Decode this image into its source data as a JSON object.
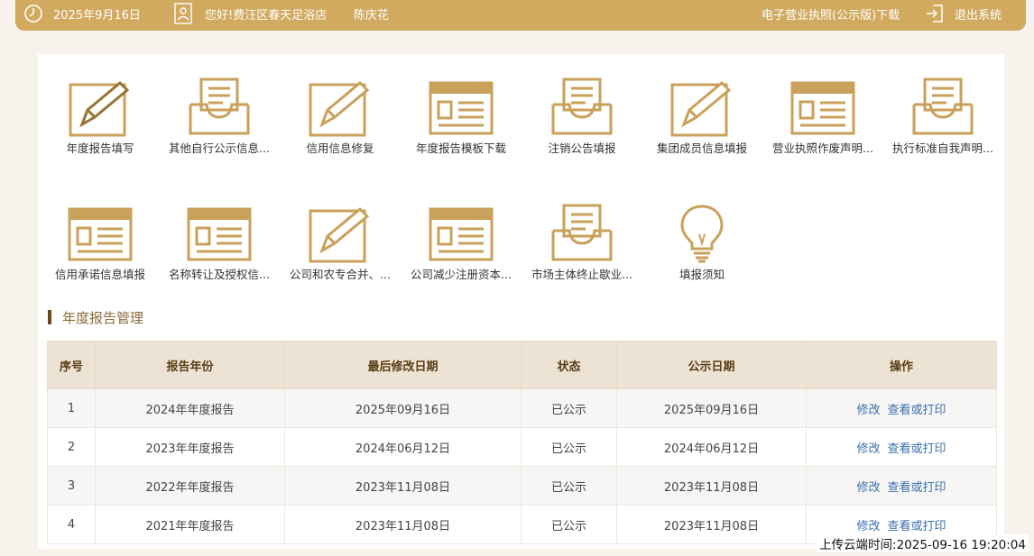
{
  "header": {
    "date": "2025年9月16日",
    "greeting": "您好!费汪区春天足浴店",
    "user_name": "陈庆花",
    "license_download": "电子营业执照(公示版)下载",
    "logout": "退出系统"
  },
  "tiles": [
    {
      "label": "年度报告填写",
      "icon": "pencil-form-icon"
    },
    {
      "label": "其他自行公示信息...",
      "icon": "inbox-tray-icon"
    },
    {
      "label": "信用信息修复",
      "icon": "pencil-form-icon"
    },
    {
      "label": "年度报告模板下载",
      "icon": "window-form-icon"
    },
    {
      "label": "注销公告填报",
      "icon": "inbox-tray-icon"
    },
    {
      "label": "集团成员信息填报",
      "icon": "pencil-form-icon"
    },
    {
      "label": "营业执照作废声明...",
      "icon": "window-form-icon"
    },
    {
      "label": "执行标准自我声明...",
      "icon": "inbox-tray-icon"
    },
    {
      "label": "信用承诺信息填报",
      "icon": "window-form-icon"
    },
    {
      "label": "名称转让及授权信...",
      "icon": "window-form-icon"
    },
    {
      "label": "公司和农专合并、...",
      "icon": "pencil-form-icon"
    },
    {
      "label": "公司减少注册资本...",
      "icon": "window-form-icon"
    },
    {
      "label": "市场主体终止歇业...",
      "icon": "inbox-tray-icon"
    },
    {
      "label": "填报须知",
      "icon": "lightbulb-icon"
    }
  ],
  "section_title": "年度报告管理",
  "table": {
    "headers": [
      "序号",
      "报告年份",
      "最后修改日期",
      "状态",
      "公示日期",
      "操作"
    ],
    "rows": [
      {
        "no": "1",
        "year": "2024年年度报告",
        "modified": "2025年09月16日",
        "status": "已公示",
        "published": "2025年09月16日"
      },
      {
        "no": "2",
        "year": "2023年年度报告",
        "modified": "2024年06月12日",
        "status": "已公示",
        "published": "2024年06月12日"
      },
      {
        "no": "3",
        "year": "2022年年度报告",
        "modified": "2023年11月08日",
        "status": "已公示",
        "published": "2023年11月08日"
      },
      {
        "no": "4",
        "year": "2021年年度报告",
        "modified": "2023年11月08日",
        "status": "已公示",
        "published": "2023年11月08日"
      }
    ],
    "action_edit": "修改",
    "action_view": "查看或打印"
  },
  "upload_time": "上传云端时间:2025-09-16 19:20:04",
  "colors": {
    "accent": "#d1aa5f",
    "icon": "#c9a15a",
    "link": "#3a6fb0"
  }
}
